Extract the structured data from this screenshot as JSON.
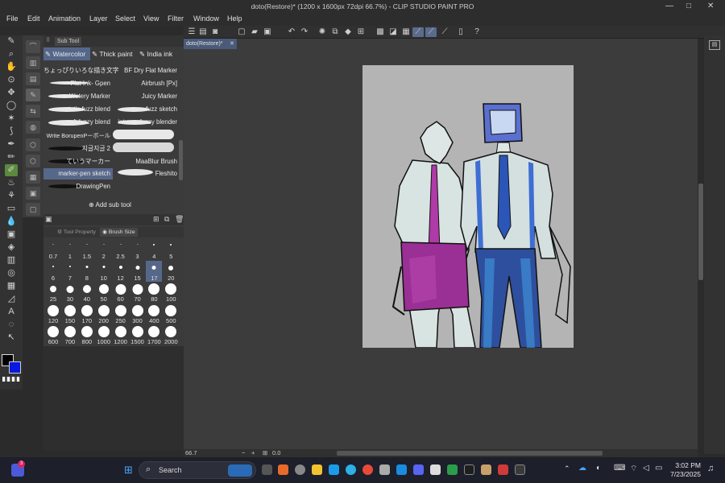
{
  "window": {
    "title": "doto(Restore)* (1200 x 1600px 72dpi 66.7%) - CLIP STUDIO PAINT PRO",
    "minimize": "—",
    "maximize": "□",
    "close": "✕"
  },
  "menu": [
    "File",
    "Edit",
    "Animation",
    "Layer",
    "Select",
    "View",
    "Filter",
    "Window",
    "Help"
  ],
  "subtool": {
    "panel_tab": "Sub Tool",
    "tabs": [
      "Watercolor",
      "Thick paint",
      "India ink"
    ],
    "brushes_left": [
      "ちょっぴりいろな描き文字",
      "Flat Ink- Gpen",
      "Watery Marker",
      "static fuzz blend",
      "soft fuzzy blend",
      "Write BorupenPーボール",
      "지글지글 2",
      "ていうマーカー",
      "marker-pen sketch",
      "DrawingPen"
    ],
    "brushes_right": [
      "BF Dry Flat Marker",
      "Airbrush [Px]",
      "Juicy Marker",
      "fuzz sketch",
      "intense fuzzy blender",
      "",
      "",
      "MaaBlur Brush",
      "Fleshito"
    ],
    "add_label": "Add sub tool",
    "selected_brush": "marker-pen sketch"
  },
  "properties": {
    "tab1": "Tool Property",
    "tab2": "Brush Size"
  },
  "brush_sizes": [
    "0.7",
    "1",
    "1.5",
    "2",
    "2.5",
    "3",
    "4",
    "5",
    "6",
    "7",
    "8",
    "10",
    "12",
    "15",
    "17",
    "20",
    "25",
    "30",
    "40",
    "50",
    "60",
    "70",
    "80",
    "100",
    "120",
    "150",
    "170",
    "200",
    "250",
    "300",
    "400",
    "500",
    "600",
    "700",
    "800",
    "1000",
    "1200",
    "1500",
    "1700",
    "2000"
  ],
  "selected_size": "17",
  "document": {
    "tab": "doto(Restore)*",
    "tab_close": "✕"
  },
  "status": {
    "zoom": "66.7",
    "angle": "0.0"
  },
  "taskbar": {
    "search": "Search",
    "time": "3:02 PM",
    "date": "7/23/2025",
    "badge": "3"
  },
  "colors": {
    "main": "#000000",
    "sub": "#0a18e0",
    "accent": "#56688a"
  }
}
